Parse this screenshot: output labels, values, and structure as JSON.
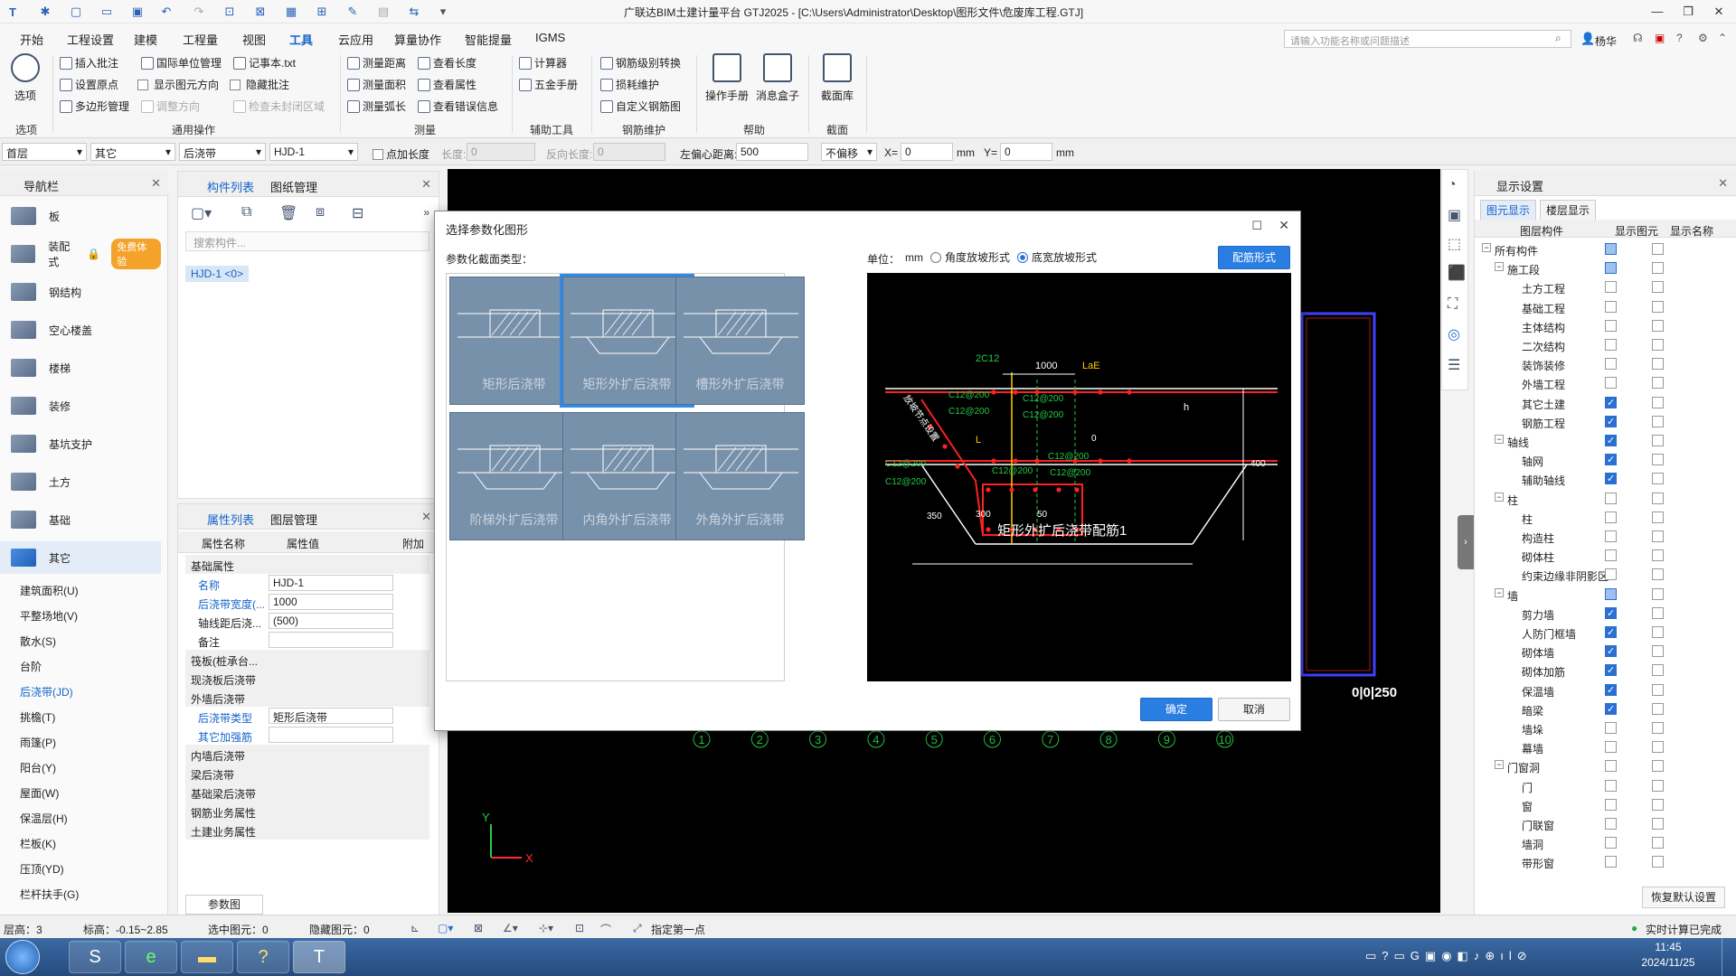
{
  "window": {
    "title": "广联达BIM土建计量平台 GTJ2025 - [C:\\Users\\Administrator\\Desktop\\图形文件\\危废库工程.GTJ]"
  },
  "menu": [
    "开始",
    "工程设置",
    "建模",
    "工程量",
    "视图",
    "工具",
    "云应用",
    "算量协作",
    "智能提量",
    "IGMS"
  ],
  "menu_active": "工具",
  "search_placeholder": "请输入功能名称或问题描述",
  "user": "杨华",
  "ribbon": {
    "options": {
      "label": "选项",
      "group": "选项"
    },
    "common": {
      "group": "通用操作",
      "items": [
        "插入批注",
        "国际单位管理",
        "记事本.txt",
        "设置原点",
        "显示图元方向",
        "隐藏批注",
        "多边形管理",
        "调整方向",
        "检查未封闭区域"
      ]
    },
    "measure": {
      "group": "测量",
      "items": [
        "测量距离",
        "查看长度",
        "测量面积",
        "查看属性",
        "测量弧长",
        "查看错误信息"
      ]
    },
    "aux": {
      "group": "辅助工具",
      "items": [
        "计算器",
        "五金手册"
      ]
    },
    "rebar": {
      "group": "钢筋维护",
      "items": [
        "钢筋级别转换",
        "损耗维护",
        "自定义钢筋图"
      ]
    },
    "help": {
      "group": "帮助",
      "items": [
        "操作手册",
        "消息盒子"
      ]
    },
    "section": {
      "group": "截面",
      "items": [
        "截面库"
      ]
    }
  },
  "optbar": {
    "floor": "首层",
    "type": "其它",
    "category": "后浇带",
    "element": "HJD-1",
    "add_length": "点加长度",
    "length": "长度:",
    "length_val": "0",
    "reverse": "反向长度:",
    "reverse_val": "0",
    "offset_label": "左偏心距离:",
    "offset_val": "500",
    "nooffset": "不偏移",
    "x_label": "X=",
    "x_val": "0",
    "y_label": "Y=",
    "y_val": "0",
    "unit": "mm"
  },
  "nav": {
    "title": "导航栏",
    "items": [
      "板",
      "装配式",
      "钢结构",
      "空心楼盖",
      "楼梯",
      "装修",
      "基坑支护",
      "土方",
      "基础",
      "其它"
    ],
    "badge": "免费体验",
    "subitems": [
      "建筑面积(U)",
      "平整场地(V)",
      "散水(S)",
      "台阶",
      "后浇带(JD)",
      "挑檐(T)",
      "雨篷(P)",
      "阳台(Y)",
      "屋面(W)",
      "保温层(H)",
      "栏板(K)",
      "压顶(YD)",
      "栏杆扶手(G)"
    ],
    "active_sub": "后浇带(JD)"
  },
  "comp": {
    "tabs": [
      "构件列表",
      "图纸管理"
    ],
    "search": "搜索构件...",
    "item": "HJD-1 <0>"
  },
  "props": {
    "tabs": [
      "属性列表",
      "图层管理"
    ],
    "headers": [
      "属性名称",
      "属性值",
      "附加"
    ],
    "rows": [
      {
        "k": "基础属性",
        "group": true
      },
      {
        "k": "名称",
        "v": "HJD-1",
        "blue": true
      },
      {
        "k": "后浇带宽度(...",
        "v": "1000",
        "blue": true
      },
      {
        "k": "轴线距后浇...",
        "v": "(500)"
      },
      {
        "k": "备注",
        "v": ""
      },
      {
        "k": "筏板(桩承台...",
        "group": true
      },
      {
        "k": "现浇板后浇带",
        "group": true
      },
      {
        "k": "外墙后浇带",
        "group": true
      },
      {
        "k": "后浇带类型",
        "v": "矩形后浇带",
        "blue": true
      },
      {
        "k": "其它加强筋",
        "v": "",
        "blue": true
      },
      {
        "k": "内墙后浇带",
        "group": true
      },
      {
        "k": "梁后浇带",
        "group": true
      },
      {
        "k": "基础梁后浇带",
        "group": true
      },
      {
        "k": "钢筋业务属性",
        "group": true
      },
      {
        "k": "土建业务属性",
        "group": true
      }
    ],
    "button": "参数图"
  },
  "display": {
    "title": "显示设置",
    "tabs": [
      "图元显示",
      "楼层显示"
    ],
    "headers": [
      "图层构件",
      "显示图元",
      "显示名称"
    ],
    "rows": [
      {
        "n": "所有构件",
        "l": 0,
        "a": "part",
        "b": "off"
      },
      {
        "n": "施工段",
        "l": 1,
        "a": "part",
        "b": "off"
      },
      {
        "n": "土方工程",
        "l": 2,
        "a": "off",
        "b": "off"
      },
      {
        "n": "基础工程",
        "l": 2,
        "a": "off",
        "b": "off"
      },
      {
        "n": "主体结构",
        "l": 2,
        "a": "off",
        "b": "off"
      },
      {
        "n": "二次结构",
        "l": 2,
        "a": "off",
        "b": "off"
      },
      {
        "n": "装饰装修",
        "l": 2,
        "a": "off",
        "b": "off"
      },
      {
        "n": "外墙工程",
        "l": 2,
        "a": "off",
        "b": "off"
      },
      {
        "n": "其它土建",
        "l": 2,
        "a": "on",
        "b": "off"
      },
      {
        "n": "钢筋工程",
        "l": 2,
        "a": "on",
        "b": "off"
      },
      {
        "n": "轴线",
        "l": 1,
        "a": "on",
        "b": "off"
      },
      {
        "n": "轴网",
        "l": 2,
        "a": "on",
        "b": "off"
      },
      {
        "n": "辅助轴线",
        "l": 2,
        "a": "on",
        "b": "off"
      },
      {
        "n": "柱",
        "l": 1,
        "a": "off",
        "b": "off"
      },
      {
        "n": "柱",
        "l": 2,
        "a": "off",
        "b": "off"
      },
      {
        "n": "构造柱",
        "l": 2,
        "a": "off",
        "b": "off"
      },
      {
        "n": "砌体柱",
        "l": 2,
        "a": "off",
        "b": "off"
      },
      {
        "n": "约束边缘非阴影区",
        "l": 2,
        "a": "off",
        "b": "off"
      },
      {
        "n": "墙",
        "l": 1,
        "a": "part",
        "b": "off"
      },
      {
        "n": "剪力墙",
        "l": 2,
        "a": "on",
        "b": "off"
      },
      {
        "n": "人防门框墙",
        "l": 2,
        "a": "on",
        "b": "off"
      },
      {
        "n": "砌体墙",
        "l": 2,
        "a": "on",
        "b": "off"
      },
      {
        "n": "砌体加筋",
        "l": 2,
        "a": "on",
        "b": "off"
      },
      {
        "n": "保温墙",
        "l": 2,
        "a": "on",
        "b": "off"
      },
      {
        "n": "暗梁",
        "l": 2,
        "a": "on",
        "b": "off"
      },
      {
        "n": "墙垛",
        "l": 2,
        "a": "off",
        "b": "off"
      },
      {
        "n": "幕墙",
        "l": 2,
        "a": "off",
        "b": "off"
      },
      {
        "n": "门窗洞",
        "l": 1,
        "a": "off",
        "b": "off"
      },
      {
        "n": "门",
        "l": 2,
        "a": "off",
        "b": "off"
      },
      {
        "n": "窗",
        "l": 2,
        "a": "off",
        "b": "off"
      },
      {
        "n": "门联窗",
        "l": 2,
        "a": "off",
        "b": "off"
      },
      {
        "n": "墙洞",
        "l": 2,
        "a": "off",
        "b": "off"
      },
      {
        "n": "带形窗",
        "l": 2,
        "a": "off",
        "b": "off"
      }
    ],
    "reset": "恢复默认设置"
  },
  "dialog": {
    "title": "选择参数化图形",
    "section_type": "参数化截面类型：",
    "unit_label": "单位：",
    "unit": "mm",
    "radio1": "角度放坡形式",
    "radio2": "底宽放坡形式",
    "rebar_btn": "配筋形式",
    "shapes": [
      "矩形后浇带",
      "矩形外扩后浇带",
      "槽形外扩后浇带",
      "阶梯外扩后浇带",
      "内角外扩后浇带",
      "外角外扩后浇带"
    ],
    "selected": 1,
    "ok": "确定",
    "cancel": "取消",
    "preview": {
      "caption": "矩形外扩后浇带配筋1",
      "labels": [
        "2C12",
        "1000",
        "LaE",
        "C12@200",
        "C12@200",
        "C12@200",
        "C12@200",
        "C12@200",
        "C12@200",
        "C12@200",
        "C12@200",
        "C12@200",
        "h",
        "400",
        "L",
        "0",
        "350",
        "300",
        "50"
      ],
      "slant": "放坡节点设置"
    }
  },
  "canvas": {
    "axis_numbers": [
      "1",
      "2",
      "3",
      "4",
      "5",
      "6",
      "7",
      "8",
      "9",
      "10"
    ],
    "dim": "0|0|250",
    "axis_x": "X",
    "axis_y": "Y"
  },
  "status": {
    "floor_h": "层高：3",
    "elev": "标高：-0.15~2.85",
    "selected": "选中图元：0",
    "hidden": "隐藏图元：0",
    "hint": "指定第一点",
    "calc": "实时计算已完成"
  },
  "clock": {
    "time": "11:45",
    "date": "2024/11/25"
  },
  "colors": {
    "accent": "#1464c8",
    "dialog_btn": "#2a7de1",
    "cell": "#7891aa",
    "red": "#ff2020",
    "yellow": "#ffd000",
    "green": "#22cc44"
  }
}
